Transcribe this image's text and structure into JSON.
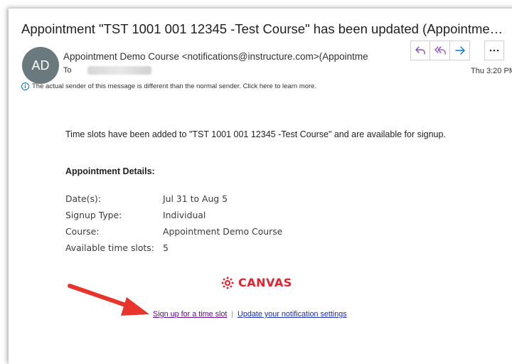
{
  "email": {
    "subject": "Appointment \"TST 1001 001 12345 -Test Course\" has been updated (Appointment...",
    "avatar_initials": "AD",
    "sender": "Appointment Demo Course <notifications@instructure.com>(Appointme",
    "to_label": "To",
    "time": "Thu 3:20 PM",
    "warning": "The actual sender of this message is different than the normal sender. Click here to learn more.",
    "body_text": "Time slots have been added to \"TST 1001 001 12345 -Test Course\" and are available for signup.",
    "details_title": "Appointment Details:",
    "details": [
      {
        "key": "Date(s):",
        "value": "Jul 31 to Aug 5"
      },
      {
        "key": "Signup Type:",
        "value": "Individual"
      },
      {
        "key": "Course:",
        "value": "Appointment Demo Course"
      },
      {
        "key": "Available time slots:",
        "value": "5"
      }
    ],
    "logo_text": "CANVAS",
    "signup_link": "Sign up for a time slot",
    "separator": "|",
    "notif_link": "Update your notification settings"
  },
  "colors": {
    "accent": "#0078d4",
    "reply_icon": "#8a4cc4",
    "forward_icon": "#0078d4",
    "canvas_red": "#e4232f",
    "arrow_red": "#e8352c"
  },
  "icons": [
    "reply-icon",
    "reply-all-icon",
    "forward-icon",
    "more-icon",
    "info-icon",
    "canvas-logo-icon",
    "annotation-arrow"
  ]
}
